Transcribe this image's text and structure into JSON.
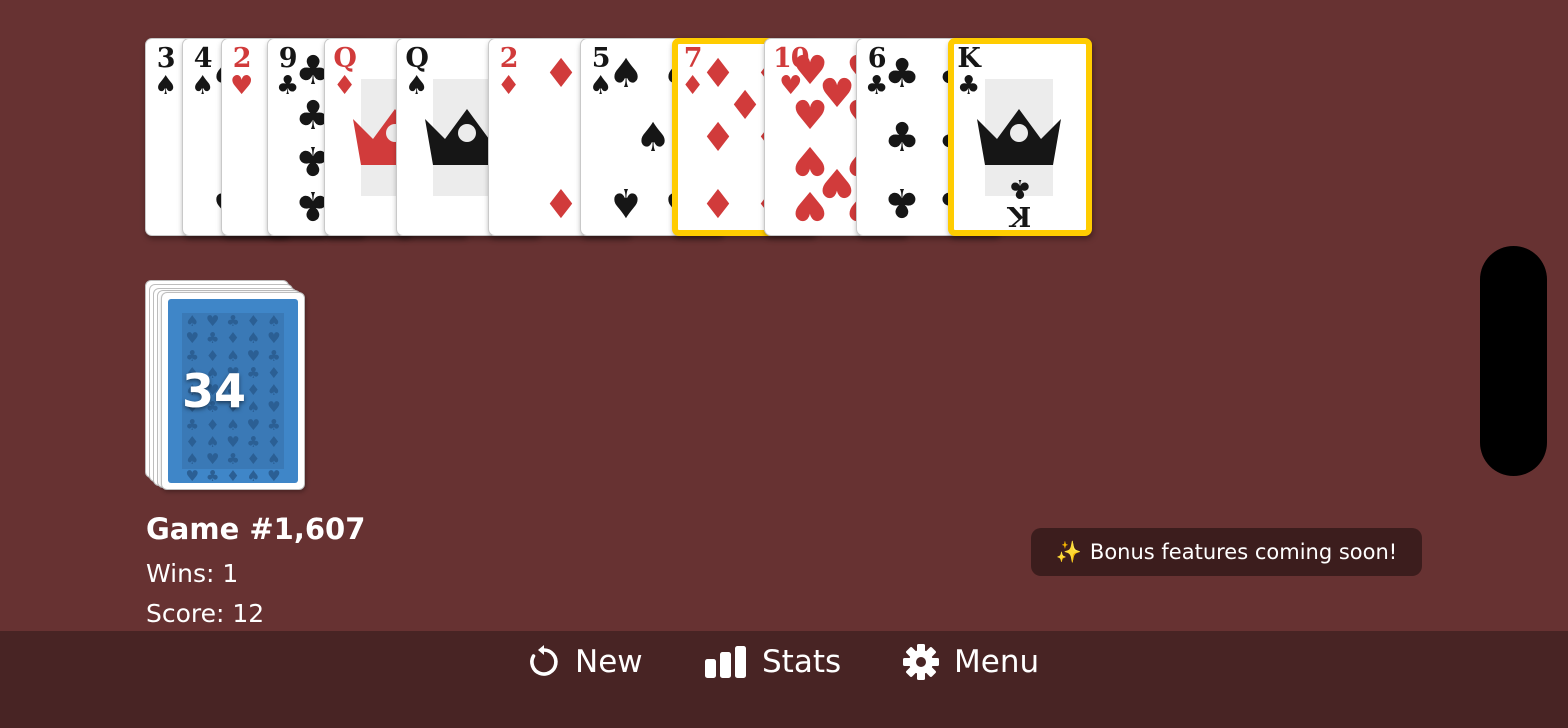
{
  "colors": {
    "felt": "#673232",
    "bottom_bar": "#482424",
    "selected_border": "#ffcc00",
    "red_suit": "#d13b3b",
    "black_suit": "#161616",
    "card_back": "#3f86c8",
    "toast_bg": "#3c1d1d"
  },
  "cards": [
    {
      "rank": "3",
      "suit": "♠",
      "suit_name": "spades",
      "color": "black",
      "selected": false
    },
    {
      "rank": "4",
      "suit": "♠",
      "suit_name": "spades",
      "color": "black",
      "selected": false
    },
    {
      "rank": "2",
      "suit": "♥",
      "suit_name": "hearts",
      "color": "red",
      "selected": false
    },
    {
      "rank": "9",
      "suit": "♣",
      "suit_name": "clubs",
      "color": "black",
      "selected": false
    },
    {
      "rank": "Q",
      "suit": "♦",
      "suit_name": "diamonds",
      "color": "red",
      "selected": false
    },
    {
      "rank": "Q",
      "suit": "♠",
      "suit_name": "spades",
      "color": "black",
      "selected": false
    },
    {
      "rank": "2",
      "suit": "♦",
      "suit_name": "diamonds",
      "color": "red",
      "selected": false
    },
    {
      "rank": "5",
      "suit": "♠",
      "suit_name": "spades",
      "color": "black",
      "selected": false
    },
    {
      "rank": "7",
      "suit": "♦",
      "suit_name": "diamonds",
      "color": "red",
      "selected": true
    },
    {
      "rank": "10",
      "suit": "♥",
      "suit_name": "hearts",
      "color": "red",
      "selected": false
    },
    {
      "rank": "6",
      "suit": "♣",
      "suit_name": "clubs",
      "color": "black",
      "selected": false
    },
    {
      "rank": "K",
      "suit": "♣",
      "suit_name": "clubs",
      "color": "black",
      "selected": true
    }
  ],
  "stock": {
    "count": "34",
    "back_pattern": "♠♥♣♦"
  },
  "info": {
    "game_title": "Game #1,607",
    "wins": "Wins: 1",
    "score": "Score: 12"
  },
  "toast": {
    "icon": "✨",
    "icon_name": "sparkles-icon",
    "text": "Bonus features coming soon!"
  },
  "bottom_bar": {
    "new_label": "New",
    "new_icon": "refresh-icon",
    "stats_label": "Stats",
    "stats_icon": "bar-chart-icon",
    "menu_label": "Menu",
    "menu_icon": "gear-icon"
  }
}
